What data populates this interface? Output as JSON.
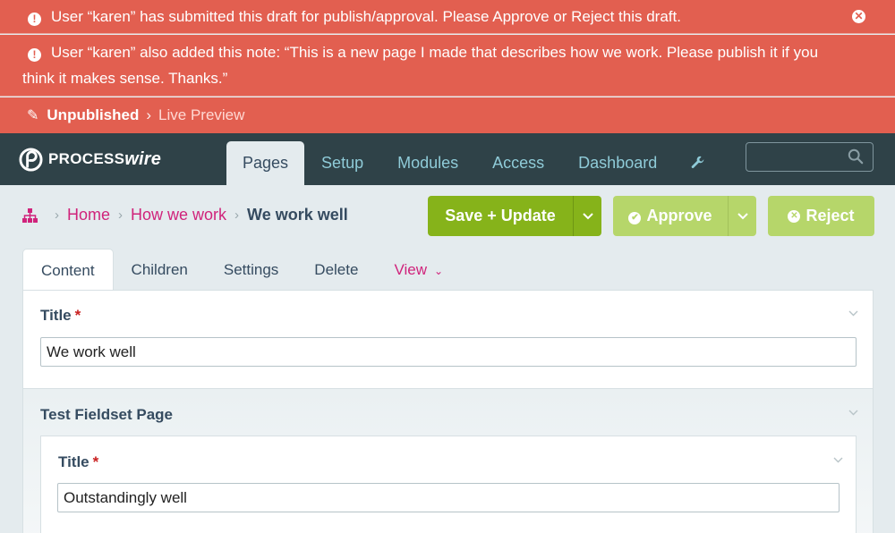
{
  "notices": {
    "submitted": "User “karen” has submitted this draft for publish/approval. Please Approve or Reject this draft.",
    "note": "User “karen” also added this note: “This is a new page I made that describes how we work. Please publish it if you think it makes sense. Thanks.”",
    "status_label": "Unpublished",
    "status_link": "Live Preview",
    "accent": "#e25f50"
  },
  "masthead": {
    "logo_a": "PROCESS",
    "logo_b": "wire",
    "nav": [
      "Pages",
      "Setup",
      "Modules",
      "Access",
      "Dashboard"
    ],
    "search_placeholder": "",
    "bg": "#2f4248"
  },
  "breadcrumbs": {
    "items": [
      "Home",
      "How we work"
    ],
    "current": "We work well"
  },
  "buttons": {
    "save": "Save + Update",
    "approve": "Approve",
    "reject": "Reject"
  },
  "tabs": [
    "Content",
    "Children",
    "Settings",
    "Delete",
    "View"
  ],
  "form": {
    "title_label": "Title",
    "title_value": "We work well",
    "fieldset_label": "Test Fieldset Page",
    "inner_title_label": "Title",
    "inner_title_value": "Outstandingly well",
    "required_mark": "*"
  }
}
